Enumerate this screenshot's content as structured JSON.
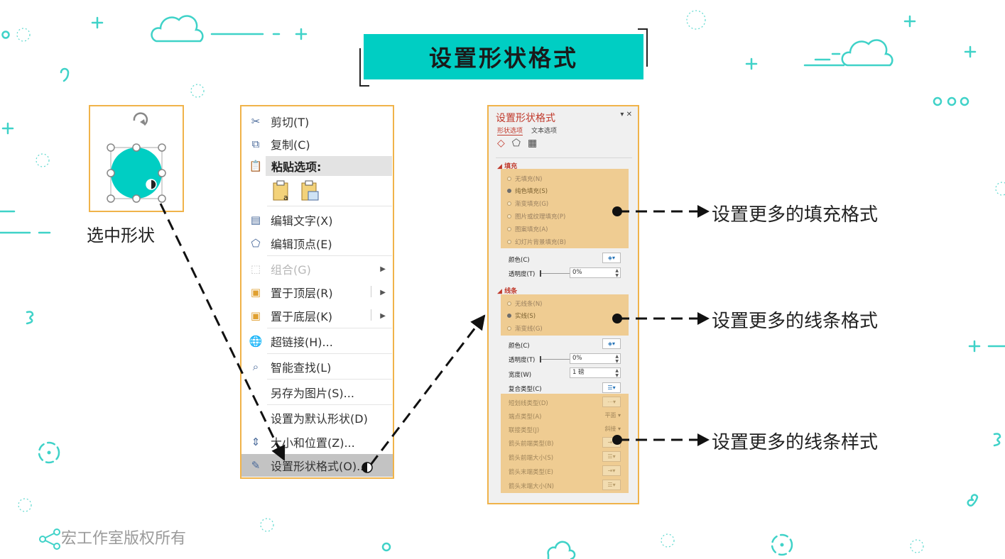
{
  "title": "设置形状格式",
  "shape_caption": "选中形状",
  "context_menu": {
    "items": [
      {
        "label": "剪切(T)",
        "icon": "scissors-icon",
        "disabled": false
      },
      {
        "label": "复制(C)",
        "icon": "copy-icon",
        "disabled": false
      },
      {
        "label": "粘贴选项:",
        "icon": "paste-icon",
        "disabled": false
      },
      {
        "label": "编辑文字(X)",
        "icon": "edit-text-icon",
        "disabled": false
      },
      {
        "label": "编辑顶点(E)",
        "icon": "edit-points-icon",
        "disabled": false
      },
      {
        "label": "组合(G)",
        "icon": "group-icon",
        "disabled": true
      },
      {
        "label": "置于顶层(R)",
        "icon": "bring-front-icon",
        "disabled": false
      },
      {
        "label": "置于底层(K)",
        "icon": "send-back-icon",
        "disabled": false
      },
      {
        "label": "超链接(H)...",
        "icon": "hyperlink-icon",
        "disabled": false
      },
      {
        "label": "智能查找(L)",
        "icon": "smart-lookup-icon",
        "disabled": false
      },
      {
        "label": "另存为图片(S)...",
        "icon": "",
        "disabled": false
      },
      {
        "label": "设置为默认形状(D)",
        "icon": "",
        "disabled": false
      },
      {
        "label": "大小和位置(Z)...",
        "icon": "size-position-icon",
        "disabled": false
      },
      {
        "label": "设置形状格式(O)...",
        "icon": "format-shape-icon",
        "disabled": false,
        "highlighted": true
      }
    ]
  },
  "format_pane": {
    "title": "设置形状格式",
    "tabs": [
      "形状选项",
      "文本选项"
    ],
    "fill_section": "填充",
    "fill_options": [
      "无填充(N)",
      "纯色填充(S)",
      "渐变填充(G)",
      "图片或纹理填充(P)",
      "图案填充(A)",
      "幻灯片背景填充(B)"
    ],
    "fill_selected": 1,
    "color_label": "颜色(C)",
    "transparency_label": "透明度(T)",
    "transparency_value": "0%",
    "line_section": "线条",
    "line_options": [
      "无线条(N)",
      "实线(S)",
      "渐变线(G)"
    ],
    "line_selected": 1,
    "line_color_label": "颜色(C)",
    "line_transparency_label": "透明度(T)",
    "line_transparency_value": "0%",
    "width_label": "宽度(W)",
    "width_value": "1 磅",
    "compound_label": "复合类型(C)",
    "dash_label": "短划线类型(D)",
    "cap_label": "端点类型(A)",
    "cap_value": "平面",
    "join_label": "联接类型(J)",
    "join_value": "斜接",
    "begin_arrow_type_label": "箭头前端类型(B)",
    "begin_arrow_size_label": "箭头前端大小(S)",
    "end_arrow_type_label": "箭头末端类型(E)",
    "end_arrow_size_label": "箭头末端大小(N)"
  },
  "annotations": {
    "fill": "设置更多的填充格式",
    "line": "设置更多的线条格式",
    "line_style": "设置更多的线条样式"
  },
  "footer": "宏工作室版权所有",
  "colors": {
    "accent": "#00cec3",
    "highlight_border": "#f0b34a",
    "highlight_fill": "#efc98a"
  }
}
